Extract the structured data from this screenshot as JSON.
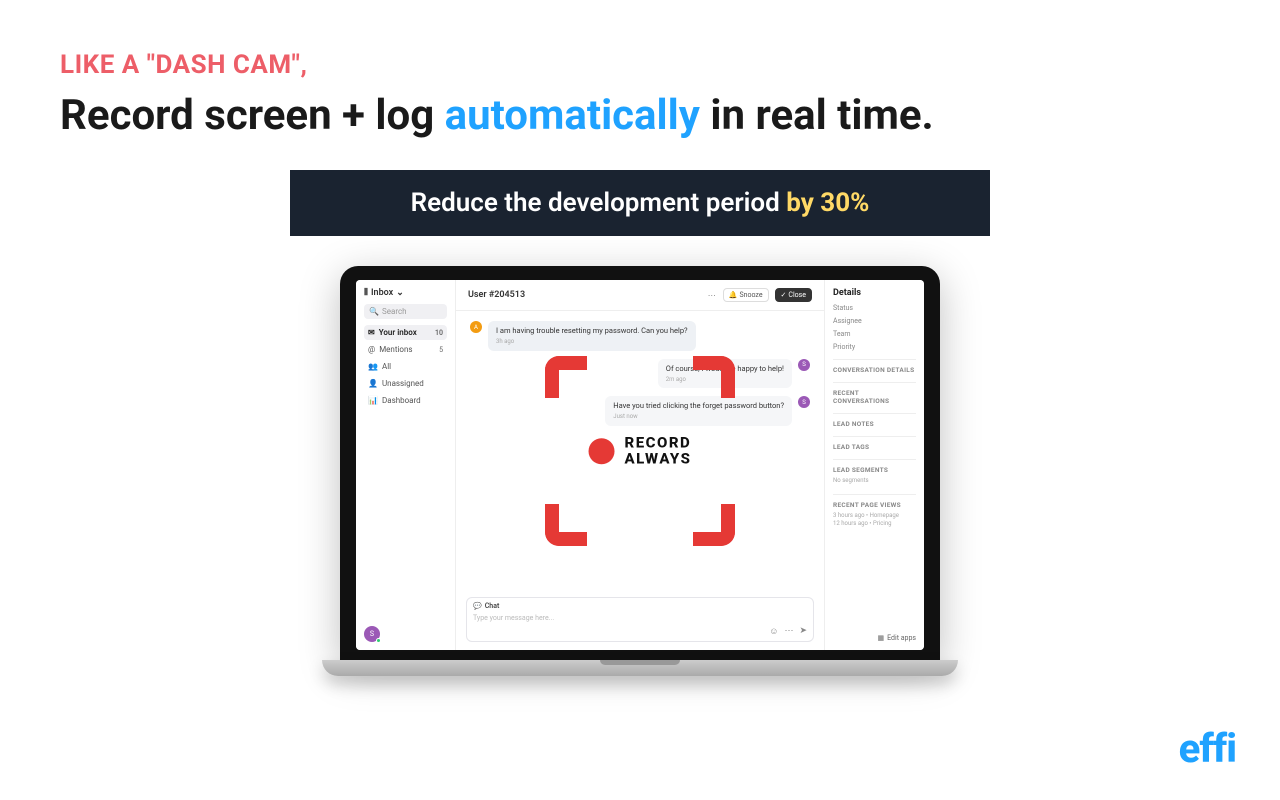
{
  "hero": {
    "eyebrow": "LIKE A \"DASH CAM\",",
    "headline_pre": "Record screen + log ",
    "headline_accent": "automatically",
    "headline_post": " in real time."
  },
  "banner": {
    "text": "Reduce the development period ",
    "accent": "by 30%"
  },
  "app": {
    "inbox_label": "Inbox",
    "search_placeholder": "Search",
    "nav": [
      {
        "icon": "tray",
        "label": "Your inbox",
        "badge": "10"
      },
      {
        "icon": "at",
        "label": "Mentions",
        "badge": "5"
      },
      {
        "icon": "users",
        "label": "All",
        "badge": ""
      },
      {
        "icon": "user-x",
        "label": "Unassigned",
        "badge": ""
      },
      {
        "icon": "chart",
        "label": "Dashboard",
        "badge": ""
      }
    ],
    "avatar_letter": "S",
    "mid": {
      "title": "User #204513",
      "snooze": "Snooze",
      "close": "Close"
    },
    "messages": {
      "m1": {
        "text": "I am having trouble resetting my password. Can you help?",
        "ts": "3h ago",
        "avatar": "A"
      },
      "m2": {
        "text": "Of course, I would be happy to help!",
        "ts": "2m ago",
        "avatar": "S"
      },
      "m3": {
        "text": "Have you tried clicking the forget password button?",
        "ts": "Just now",
        "avatar": "S"
      }
    },
    "compose": {
      "tab": "Chat",
      "placeholder": "Type your message here..."
    },
    "details": {
      "title": "Details",
      "fields": [
        "Status",
        "Assignee",
        "Team",
        "Priority"
      ],
      "sections": [
        "CONVERSATION DETAILS",
        "RECENT CONVERSATIONS",
        "LEAD NOTES",
        "LEAD TAGS",
        "LEAD SEGMENTS",
        "RECENT PAGE VIEWS"
      ],
      "no_segments": "No segments",
      "pv1": "3 hours ago  •  Homepage",
      "pv2": "12 hours ago  •  Pricing",
      "edit_apps": "Edit apps"
    }
  },
  "record": {
    "line1": "RECORD",
    "line2": "ALWAYS"
  },
  "brand": "effi"
}
